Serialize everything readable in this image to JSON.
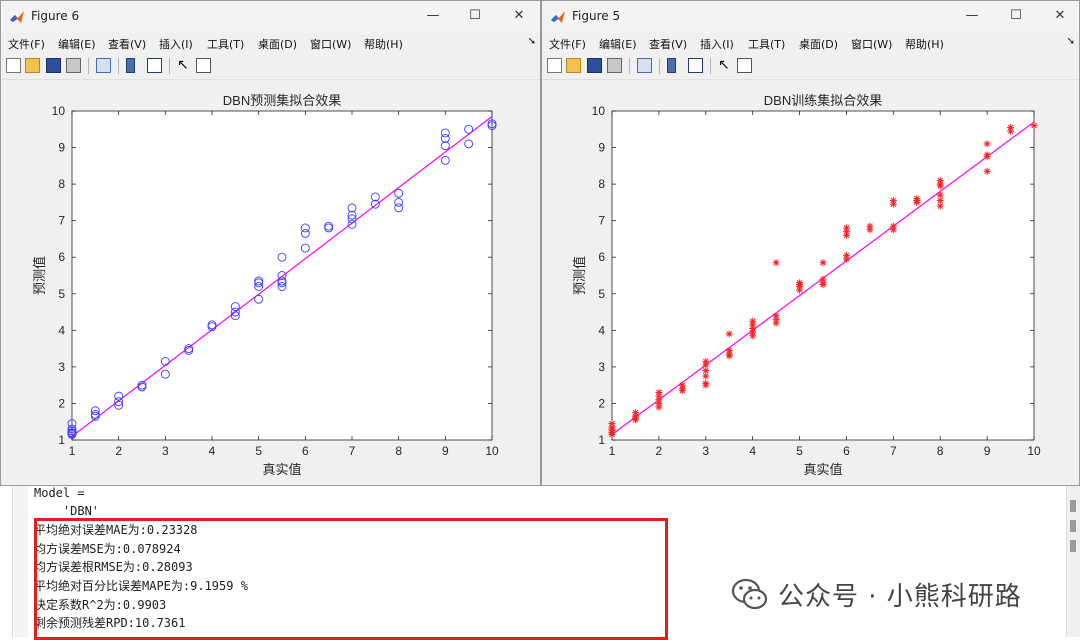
{
  "console": {
    "lines_top": [
      "Model =",
      "    'DBN'"
    ],
    "metrics": [
      "平均绝对误差MAE为:0.23328",
      "均方误差MSE为:0.078924",
      "均方误差根RMSE为:0.28093",
      "平均绝对百分比误差MAPE为:9.1959 %",
      "决定系数R^2为:0.9903",
      "剩余预测残差RPD:10.7361"
    ]
  },
  "watermark": {
    "text": "公众号 · 小熊科研路"
  },
  "windows": [
    {
      "id": "fig6",
      "title": "Figure 6",
      "menu": [
        "文件(F)",
        "编辑(E)",
        "查看(V)",
        "插入(I)",
        "工具(T)",
        "桌面(D)",
        "窗口(W)",
        "帮助(H)"
      ],
      "controls": {
        "minimize": "—",
        "maximize": "☐",
        "close": "✕"
      }
    },
    {
      "id": "fig5",
      "title": "Figure 5",
      "menu": [
        "文件(F)",
        "编辑(E)",
        "查看(V)",
        "插入(I)",
        "工具(T)",
        "桌面(D)",
        "窗口(W)",
        "帮助(H)"
      ],
      "controls": {
        "minimize": "—",
        "maximize": "☐",
        "close": "✕"
      }
    }
  ],
  "chart_data": [
    {
      "type": "scatter",
      "title": "DBN预测集拟合效果",
      "xlabel": "真实值",
      "ylabel": "预测值",
      "xlim": [
        1,
        10
      ],
      "ylim": [
        1,
        10
      ],
      "xticks": [
        1,
        2,
        3,
        4,
        5,
        6,
        7,
        8,
        9,
        10
      ],
      "yticks": [
        1,
        2,
        3,
        4,
        5,
        6,
        7,
        8,
        9,
        10
      ],
      "marker": "circle",
      "marker_color": "#3b3bff",
      "line_color": "#ff00ff",
      "fit_line": {
        "x": [
          1,
          10
        ],
        "y": [
          1.1,
          9.85
        ]
      },
      "points": [
        [
          1,
          1.45
        ],
        [
          1,
          1.3
        ],
        [
          1,
          1.25
        ],
        [
          1,
          1.2
        ],
        [
          1,
          1.18
        ],
        [
          1,
          1.15
        ],
        [
          1.5,
          1.8
        ],
        [
          1.5,
          1.7
        ],
        [
          1.5,
          1.65
        ],
        [
          2,
          2.2
        ],
        [
          2,
          2.05
        ],
        [
          2,
          1.95
        ],
        [
          2.5,
          2.5
        ],
        [
          2.5,
          2.45
        ],
        [
          3,
          3.15
        ],
        [
          3,
          2.8
        ],
        [
          3.5,
          3.5
        ],
        [
          3.5,
          3.45
        ],
        [
          4,
          4.15
        ],
        [
          4,
          4.1
        ],
        [
          4.5,
          4.65
        ],
        [
          4.5,
          4.5
        ],
        [
          4.5,
          4.4
        ],
        [
          5,
          5.35
        ],
        [
          5,
          5.3
        ],
        [
          5,
          5.2
        ],
        [
          5,
          4.85
        ],
        [
          5.5,
          6.0
        ],
        [
          5.5,
          5.5
        ],
        [
          5.5,
          5.35
        ],
        [
          5.5,
          5.3
        ],
        [
          5.5,
          5.2
        ],
        [
          6,
          6.8
        ],
        [
          6,
          6.65
        ],
        [
          6,
          6.25
        ],
        [
          6.5,
          6.85
        ],
        [
          6.5,
          6.8
        ],
        [
          7,
          7.35
        ],
        [
          7,
          7.15
        ],
        [
          7,
          7.05
        ],
        [
          7,
          6.9
        ],
        [
          7.5,
          7.65
        ],
        [
          7.5,
          7.45
        ],
        [
          8,
          7.75
        ],
        [
          8,
          7.5
        ],
        [
          8,
          7.35
        ],
        [
          9,
          9.4
        ],
        [
          9,
          9.25
        ],
        [
          9,
          9.05
        ],
        [
          9,
          8.65
        ],
        [
          9.5,
          9.5
        ],
        [
          9.5,
          9.1
        ],
        [
          10,
          9.65
        ],
        [
          10,
          9.6
        ]
      ]
    },
    {
      "type": "scatter",
      "title": "DBN训练集拟合效果",
      "xlabel": "真实值",
      "ylabel": "预测值",
      "xlim": [
        1,
        10
      ],
      "ylim": [
        1,
        10
      ],
      "xticks": [
        1,
        2,
        3,
        4,
        5,
        6,
        7,
        8,
        9,
        10
      ],
      "yticks": [
        1,
        2,
        3,
        4,
        5,
        6,
        7,
        8,
        9,
        10
      ],
      "marker": "asterisk",
      "marker_color": "#ff2020",
      "line_color": "#ff00ff",
      "fit_line": {
        "x": [
          1,
          10
        ],
        "y": [
          1.15,
          9.7
        ]
      },
      "points": [
        [
          1,
          1.45
        ],
        [
          1,
          1.35
        ],
        [
          1,
          1.3
        ],
        [
          1,
          1.2
        ],
        [
          1,
          1.15
        ],
        [
          1,
          1.25
        ],
        [
          1.5,
          1.75
        ],
        [
          1.5,
          1.65
        ],
        [
          1.5,
          1.6
        ],
        [
          1.5,
          1.55
        ],
        [
          2,
          2.3
        ],
        [
          2,
          2.2
        ],
        [
          2,
          2.1
        ],
        [
          2,
          2.0
        ],
        [
          2,
          1.9
        ],
        [
          2.5,
          2.5
        ],
        [
          2.5,
          2.4
        ],
        [
          2.5,
          2.35
        ],
        [
          3,
          3.15
        ],
        [
          3,
          3.05
        ],
        [
          3,
          2.9
        ],
        [
          3,
          2.75
        ],
        [
          3,
          2.55
        ],
        [
          3,
          2.5
        ],
        [
          3.5,
          3.9
        ],
        [
          3.5,
          3.45
        ],
        [
          3.5,
          3.35
        ],
        [
          3.5,
          3.3
        ],
        [
          4,
          4.25
        ],
        [
          4,
          4.15
        ],
        [
          4,
          4.05
        ],
        [
          4,
          3.95
        ],
        [
          4,
          3.85
        ],
        [
          4.5,
          5.85
        ],
        [
          4.5,
          4.4
        ],
        [
          4.5,
          4.3
        ],
        [
          4.5,
          4.2
        ],
        [
          5,
          5.3
        ],
        [
          5,
          5.25
        ],
        [
          5,
          5.2
        ],
        [
          5,
          5.1
        ],
        [
          5.5,
          5.85
        ],
        [
          5.5,
          5.4
        ],
        [
          5.5,
          5.3
        ],
        [
          5.5,
          5.25
        ],
        [
          6,
          6.8
        ],
        [
          6,
          6.7
        ],
        [
          6,
          6.6
        ],
        [
          6,
          6.05
        ],
        [
          6,
          5.95
        ],
        [
          6.5,
          6.85
        ],
        [
          6.5,
          6.75
        ],
        [
          7,
          7.55
        ],
        [
          7,
          7.45
        ],
        [
          7,
          6.85
        ],
        [
          7,
          6.75
        ],
        [
          7.5,
          7.6
        ],
        [
          7.5,
          7.55
        ],
        [
          7.5,
          7.5
        ],
        [
          8,
          8.1
        ],
        [
          8,
          8.0
        ],
        [
          8,
          7.95
        ],
        [
          8,
          7.7
        ],
        [
          8,
          7.55
        ],
        [
          8,
          7.4
        ],
        [
          9,
          9.1
        ],
        [
          9,
          8.8
        ],
        [
          9,
          8.75
        ],
        [
          9,
          8.35
        ],
        [
          9.5,
          9.55
        ],
        [
          9.5,
          9.45
        ],
        [
          10,
          9.6
        ]
      ]
    }
  ]
}
